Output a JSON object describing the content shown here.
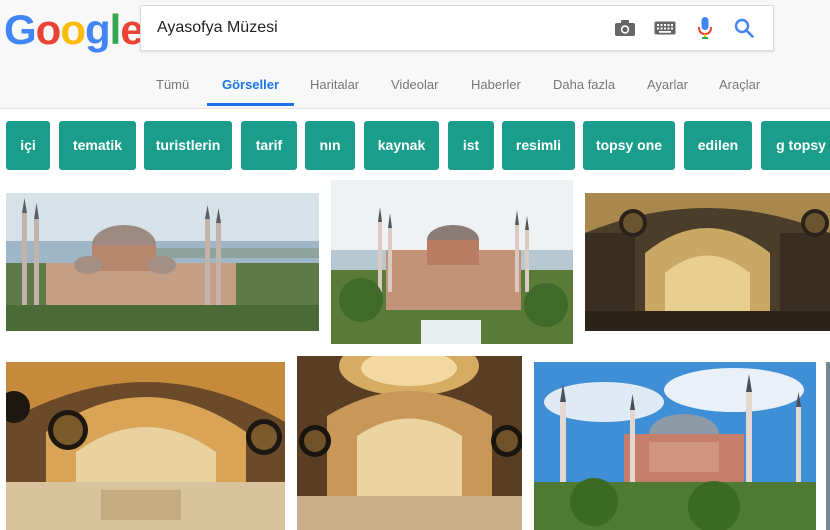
{
  "logo": {
    "letters": [
      "G",
      "o",
      "o",
      "g",
      "l",
      "e"
    ],
    "colors": [
      "#4285f4",
      "#ea4335",
      "#fbbc05",
      "#4285f4",
      "#34a853",
      "#ea4335"
    ]
  },
  "search": {
    "query": "Ayasofya Müzesi"
  },
  "icons": {
    "camera": "camera-icon",
    "keyboard": "keyboard-icon",
    "mic": "microphone-icon",
    "search": "search-icon"
  },
  "tabs": [
    {
      "label": "Tümü",
      "active": false
    },
    {
      "label": "Görseller",
      "active": true
    },
    {
      "label": "Haritalar",
      "active": false
    },
    {
      "label": "Videolar",
      "active": false
    },
    {
      "label": "Haberler",
      "active": false
    },
    {
      "label": "Daha fazla",
      "active": false
    },
    {
      "label": "Ayarlar",
      "active": false
    },
    {
      "label": "Araçlar",
      "active": false
    }
  ],
  "chips": [
    "içi",
    "tematik",
    "turistlerin",
    "tarif",
    "nın",
    "kaynak",
    "ist",
    "resimli",
    "topsy one",
    "edilen",
    "g topsy"
  ],
  "colors": {
    "chip": "#1b9d8c",
    "accent": "#1a73e8"
  }
}
